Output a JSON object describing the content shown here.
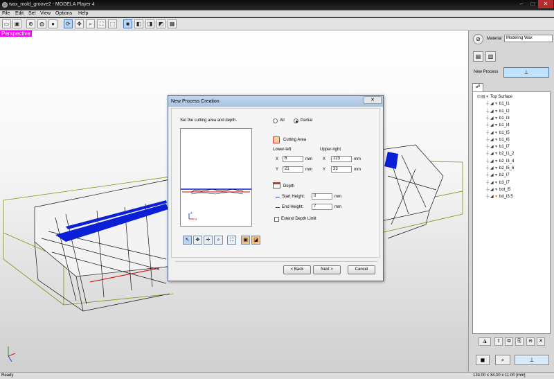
{
  "window": {
    "title": "wax_mold_groove2 - MODELA Player 4",
    "min": "–",
    "max": "□",
    "close": "✕"
  },
  "menu": [
    "File",
    "Edit",
    "Set",
    "View",
    "Options",
    "Help"
  ],
  "toolbar": {
    "icons": [
      "new-icon",
      "save-icon",
      "sphere-wire-icon",
      "globe-icon",
      "globe-solid-icon",
      "rotate-icon",
      "pan-icon",
      "zoom-icon",
      "zoom-fit-icon",
      "zoom-window-icon",
      "box-front-icon",
      "box-top-icon",
      "box-side-icon",
      "box-iso-icon",
      "grid-icon"
    ]
  },
  "viewport": {
    "label": "Perspective"
  },
  "right_panel": {
    "material_label": "Material",
    "material_value": "Modeling Wax",
    "new_process_label": "New Process",
    "tree": [
      {
        "label": "Top Surface",
        "expanded": true,
        "level": 0
      },
      {
        "label": "b1_l1",
        "level": 1
      },
      {
        "label": "b1_l2",
        "level": 1
      },
      {
        "label": "b1_l3",
        "level": 1
      },
      {
        "label": "b1_l4",
        "level": 1
      },
      {
        "label": "b1_l5",
        "level": 1
      },
      {
        "label": "b1_l6",
        "level": 1
      },
      {
        "label": "b1_l7",
        "level": 1
      },
      {
        "label": "b2_l1_2",
        "level": 1
      },
      {
        "label": "b2_l3_4",
        "level": 1
      },
      {
        "label": "b2_l5_6",
        "level": 1
      },
      {
        "label": "b2_l7",
        "level": 1
      },
      {
        "label": "b3_l7",
        "level": 1
      },
      {
        "label": "bot_l5",
        "level": 1
      },
      {
        "label": "bd_l3.5",
        "level": 1
      }
    ]
  },
  "status": {
    "left": "Ready",
    "right": "124.00 x 34.00 x 11.00 [mm]"
  },
  "dialog": {
    "title": "New Process Creation",
    "close": "✕",
    "instruction": "Set the cutting area and depth.",
    "radio_all": "All",
    "radio_partial": "Partial",
    "cutting_area_label": "Cutting Area",
    "lower_left_label": "Lower-left",
    "upper_right_label": "Upper-right",
    "x_label": "X",
    "y_label": "Y",
    "ll_x": "6",
    "ll_y": "21",
    "ur_x": "123",
    "ur_y": "33",
    "unit": "mm",
    "depth_label": "Depth",
    "start_height_label": "Start Height:",
    "start_height": "0",
    "end_height_label": "End Height:",
    "end_height": "7",
    "extend_depth_label": "Extend Depth Limit",
    "back": "< Back",
    "next": "Next >",
    "cancel": "Cancel"
  }
}
